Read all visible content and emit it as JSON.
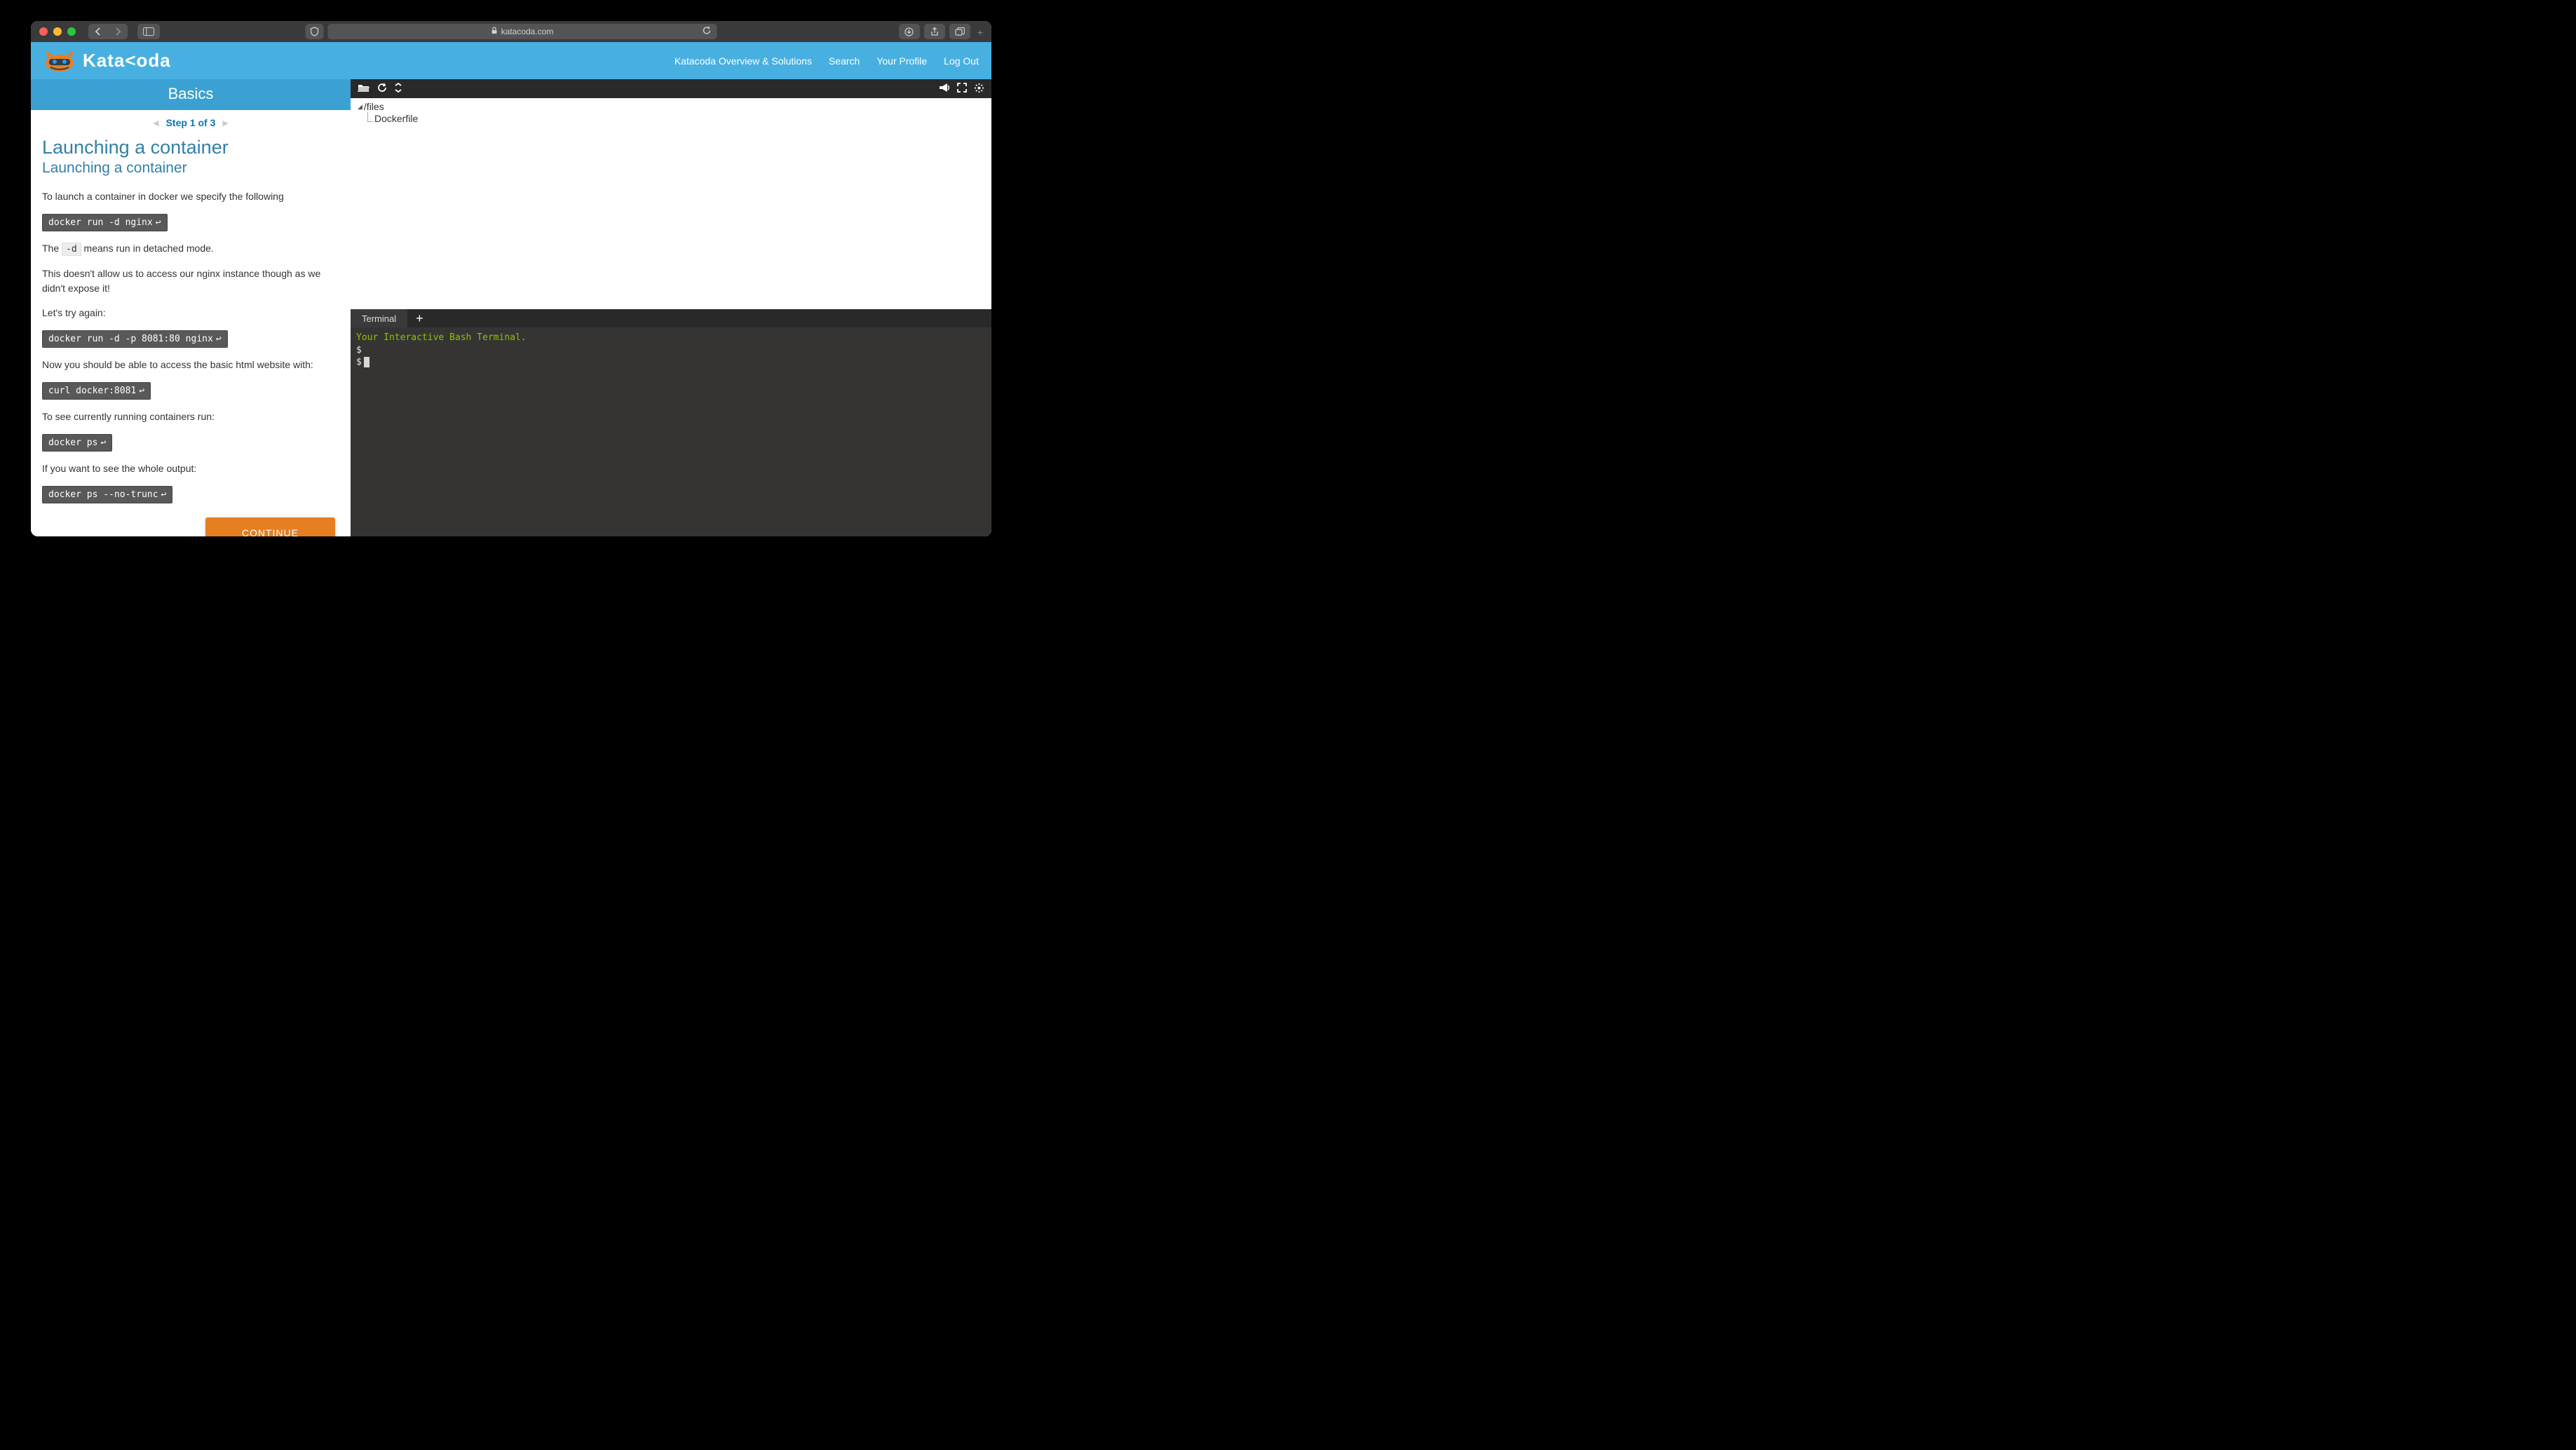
{
  "browser": {
    "url_host": "katacoda.com"
  },
  "header": {
    "logo_text": "Kata<oda",
    "nav": {
      "overview": "Katacoda Overview & Solutions",
      "search": "Search",
      "profile": "Your Profile",
      "logout": "Log Out"
    }
  },
  "lesson": {
    "title_bar": "Basics",
    "step_label": "Step 1 of 3",
    "h1": "Launching a container",
    "h2": "Launching a container",
    "p1": "To launch a container in docker we specify the following",
    "code1": "docker run -d nginx",
    "p2_a": "The ",
    "p2_code": "-d",
    "p2_b": " means run in detached mode.",
    "p3": "This doesn't allow us to access our nginx instance though as we didn't expose it!",
    "p4": "Let's try again:",
    "code2": "docker run -d -p 8081:80 nginx",
    "p5": "Now you should be able to access the basic html website with:",
    "code3": "curl docker:8081",
    "p6": "To see currently running containers run:",
    "code4": "docker ps",
    "p7": "If you want to see the whole output:",
    "code5": "docker ps --no-trunc",
    "continue": "CONTINUE"
  },
  "files": {
    "root": "/files",
    "file1": "Dockerfile"
  },
  "terminal": {
    "tab": "Terminal",
    "greeting": "Your Interactive Bash Terminal.",
    "prompt": "$"
  }
}
